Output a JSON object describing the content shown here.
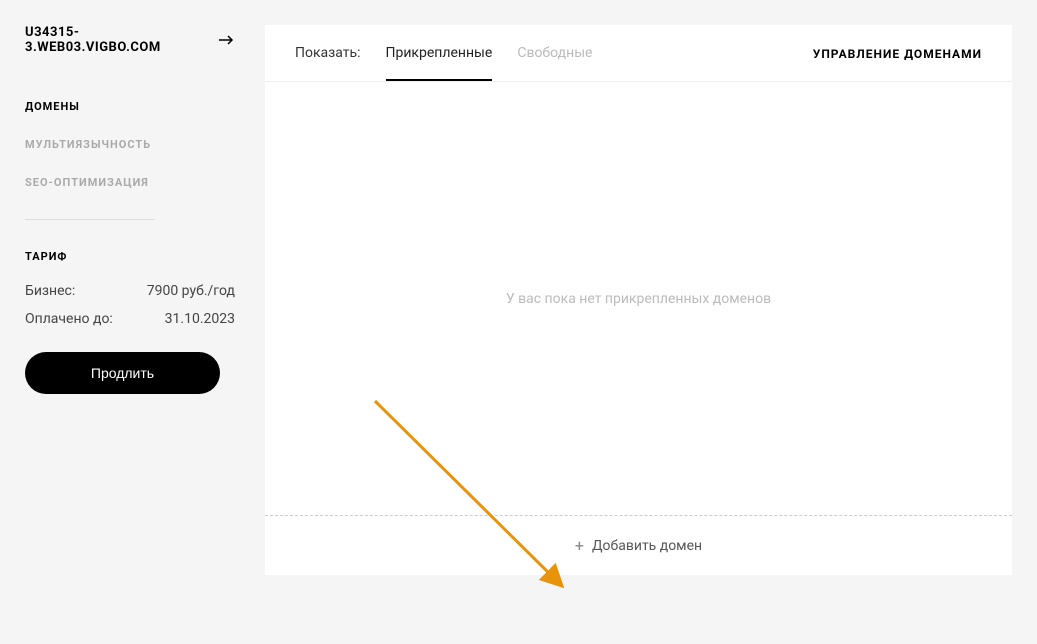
{
  "header": {
    "site_title": "U34315-3.WEB03.VIGBO.COM"
  },
  "sidebar": {
    "items": [
      {
        "label": "ДОМЕНЫ",
        "active": true
      },
      {
        "label": "МУЛЬТИЯЗЫЧНОСТЬ",
        "active": false
      },
      {
        "label": "SEO-ОПТИМИЗАЦИЯ",
        "active": false
      }
    ],
    "tariff": {
      "heading": "ТАРИФ",
      "plan_label": "Бизнес:",
      "plan_value": "7900 руб./год",
      "paid_label": "Оплачено до:",
      "paid_value": "31.10.2023",
      "extend_button": "Продлить"
    }
  },
  "main": {
    "filter_label": "Показать:",
    "tabs": [
      {
        "label": "Прикрепленные",
        "active": true
      },
      {
        "label": "Свободные",
        "active": false
      }
    ],
    "manage_domains": "УПРАВЛЕНИЕ ДОМЕНАМИ",
    "empty_message": "У вас пока нет прикрепленных доменов",
    "add_domain": "Добавить домен"
  },
  "annotation": {
    "arrow_color": "#e8930c"
  }
}
